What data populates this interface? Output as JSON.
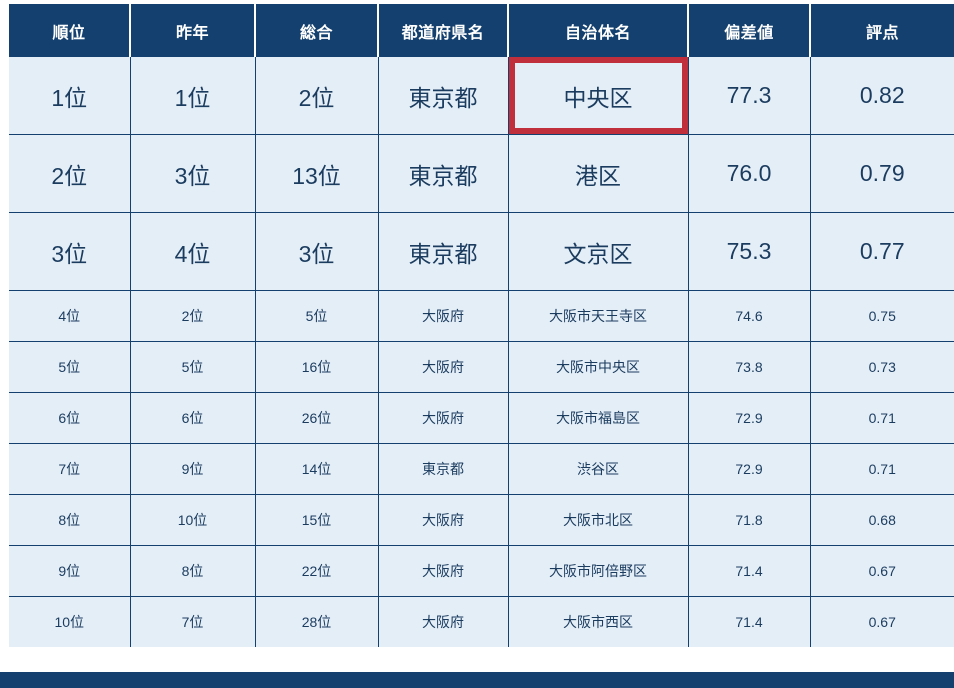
{
  "table": {
    "columns": [
      {
        "key": "rank",
        "label": "順位"
      },
      {
        "key": "last",
        "label": "昨年"
      },
      {
        "key": "total",
        "label": "総合"
      },
      {
        "key": "pref",
        "label": "都道府県名"
      },
      {
        "key": "city",
        "label": "自治体名"
      },
      {
        "key": "dev",
        "label": "偏差値"
      },
      {
        "key": "score",
        "label": "評点"
      }
    ],
    "rows": [
      {
        "rank": "1位",
        "last": "1位",
        "total": "2位",
        "pref": "東京都",
        "city": "中央区",
        "dev": "77.3",
        "score": "0.82",
        "emphasis": "large",
        "highlight": "city"
      },
      {
        "rank": "2位",
        "last": "3位",
        "total": "13位",
        "pref": "東京都",
        "city": "港区",
        "dev": "76.0",
        "score": "0.79",
        "emphasis": "large",
        "highlight": null
      },
      {
        "rank": "3位",
        "last": "4位",
        "total": "3位",
        "pref": "東京都",
        "city": "文京区",
        "dev": "75.3",
        "score": "0.77",
        "emphasis": "large",
        "highlight": null
      },
      {
        "rank": "4位",
        "last": "2位",
        "total": "5位",
        "pref": "大阪府",
        "city": "大阪市天王寺区",
        "dev": "74.6",
        "score": "0.75",
        "emphasis": "normal",
        "highlight": null
      },
      {
        "rank": "5位",
        "last": "5位",
        "total": "16位",
        "pref": "大阪府",
        "city": "大阪市中央区",
        "dev": "73.8",
        "score": "0.73",
        "emphasis": "normal",
        "highlight": null
      },
      {
        "rank": "6位",
        "last": "6位",
        "total": "26位",
        "pref": "大阪府",
        "city": "大阪市福島区",
        "dev": "72.9",
        "score": "0.71",
        "emphasis": "normal",
        "highlight": null
      },
      {
        "rank": "7位",
        "last": "9位",
        "total": "14位",
        "pref": "東京都",
        "city": "渋谷区",
        "dev": "72.9",
        "score": "0.71",
        "emphasis": "normal",
        "highlight": null
      },
      {
        "rank": "8位",
        "last": "10位",
        "total": "15位",
        "pref": "大阪府",
        "city": "大阪市北区",
        "dev": "71.8",
        "score": "0.68",
        "emphasis": "normal",
        "highlight": null
      },
      {
        "rank": "9位",
        "last": "8位",
        "total": "22位",
        "pref": "大阪府",
        "city": "大阪市阿倍野区",
        "dev": "71.4",
        "score": "0.67",
        "emphasis": "normal",
        "highlight": null
      },
      {
        "rank": "10位",
        "last": "7位",
        "total": "28位",
        "pref": "大阪府",
        "city": "大阪市西区",
        "dev": "71.4",
        "score": "0.67",
        "emphasis": "normal",
        "highlight": null
      }
    ]
  },
  "colors": {
    "header_background": "#13406e",
    "row_background": "#e4eef7",
    "border": "#13406e",
    "text": "#1b3c5f",
    "header_text": "#ffffff",
    "highlight_border": "#c0303c"
  }
}
